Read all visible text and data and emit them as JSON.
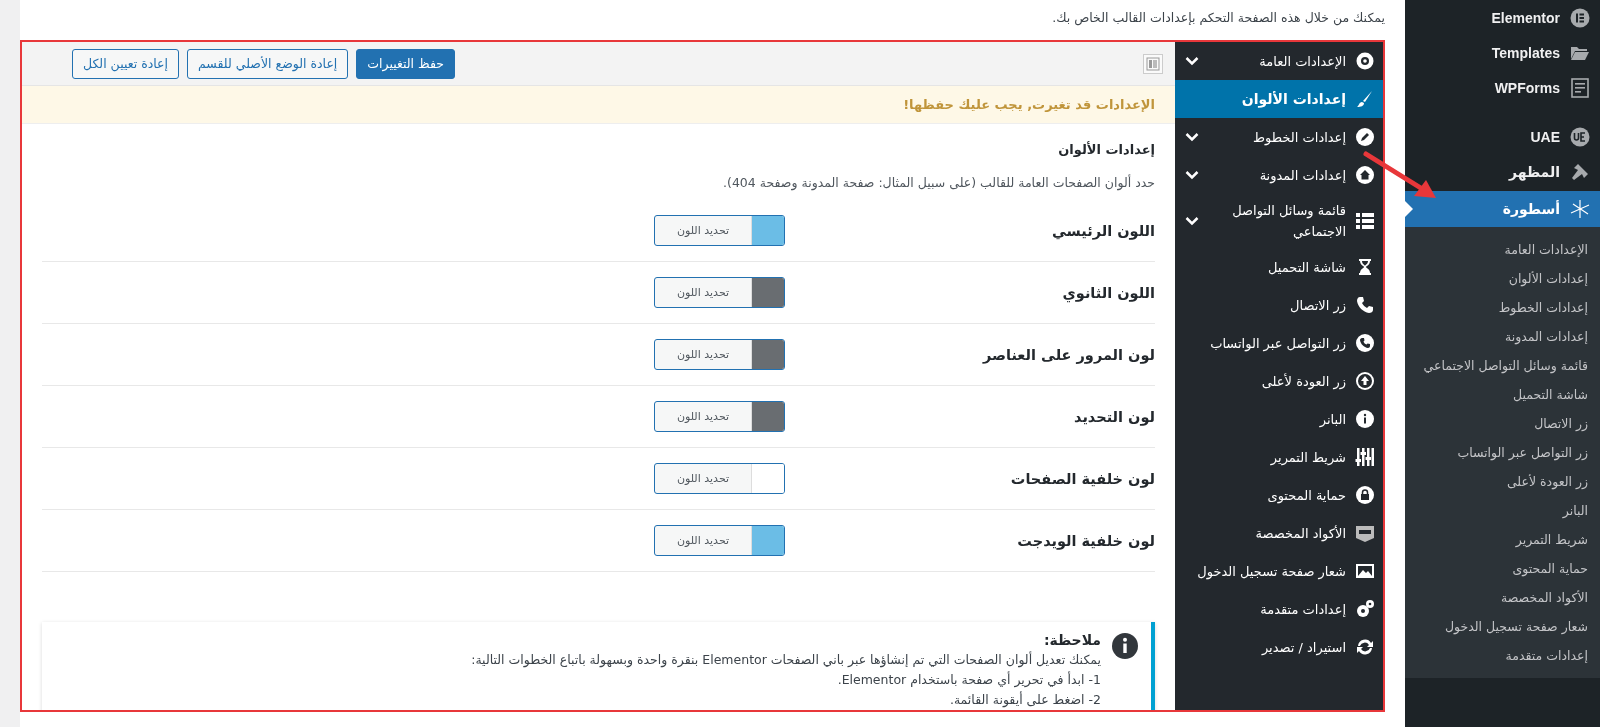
{
  "page_intro": "يمكنك من خلال هذه الصفحة التحكم بإعدادات القالب الخاص بك.",
  "toolbar": {
    "buttons": [
      {
        "label": "حفظ التغييرات",
        "kind": "primary"
      },
      {
        "label": "إعادة الوضع الأصلي للقسم",
        "kind": "secondary"
      },
      {
        "label": "إعادة تعيين الكل",
        "kind": "secondary"
      }
    ]
  },
  "notice": "الإعدادات قد تغيرت, يجب عليك حفظها!",
  "color_settings": {
    "title": "إعدادات الألوان",
    "description": "حدد ألوان الصفحات العامة للقالب (على سبيل المثال: صفحة المدونة وصفحة 404).",
    "rows": [
      {
        "label": "اللون الرئيسي",
        "button": "تحديد اللون",
        "color": "#6bbde6"
      },
      {
        "label": "اللون الثانوي",
        "button": "تحديد اللون",
        "color": "#696d71"
      },
      {
        "label": "لون المرور على العناصر",
        "button": "تحديد اللون",
        "color": "#696d71"
      },
      {
        "label": "لون التحديد",
        "button": "تحديد اللون",
        "color": "#696d71"
      },
      {
        "label": "لون خلفية الصفحات",
        "button": "تحديد اللون",
        "color": "#ffffff"
      },
      {
        "label": "لون خلفية الويدجت",
        "button": "تحديد اللون",
        "color": "#6bbde6"
      }
    ]
  },
  "note": {
    "title": "ملاحظة:",
    "lines": [
      "يمكنك تعديل ألوان الصفحات التي تم إنشاؤها عبر باني الصفحات Elementor بنقرة واحدة وبسهولة باتباع الخطوات التالية:",
      "1- ابدأ في تحرير أي صفحة باستخدام Elementor.",
      "2- اضغط على أيقونة القائمة."
    ]
  },
  "options_sidebar": {
    "items": [
      {
        "label": "الإعدادات العامة",
        "selected": false,
        "expandable": true
      },
      {
        "label": "إعدادات الألوان",
        "selected": true,
        "expandable": false
      },
      {
        "label": "إعدادات الخطوط",
        "selected": false,
        "expandable": true
      },
      {
        "label": "إعدادات المدونة",
        "selected": false,
        "expandable": true
      },
      {
        "label": "قائمة وسائل التواصل الاجتماعي",
        "selected": false,
        "expandable": true
      },
      {
        "label": "شاشة التحميل",
        "selected": false,
        "expandable": false
      },
      {
        "label": "زر الاتصال",
        "selected": false,
        "expandable": false
      },
      {
        "label": "زر التواصل عبر الواتساب",
        "selected": false,
        "expandable": false
      },
      {
        "label": "زر العودة لأعلى",
        "selected": false,
        "expandable": false
      },
      {
        "label": "البانر",
        "selected": false,
        "expandable": false
      },
      {
        "label": "شريط التمرير",
        "selected": false,
        "expandable": false
      },
      {
        "label": "حماية المحتوى",
        "selected": false,
        "expandable": false
      },
      {
        "label": "الأكواد المخصصة",
        "selected": false,
        "expandable": false
      },
      {
        "label": "شعار صفحة تسجيل الدخول",
        "selected": false,
        "expandable": false
      },
      {
        "label": "إعدادات متقدمة",
        "selected": false,
        "expandable": false
      },
      {
        "label": "استيراد / تصدير",
        "selected": false,
        "expandable": false
      }
    ]
  },
  "admin_menu": {
    "items": [
      {
        "label": "Elementor",
        "selected": false
      },
      {
        "label": "Templates",
        "selected": false
      },
      {
        "label": "WPForms",
        "selected": false
      },
      {
        "label": "UAE",
        "selected": false
      },
      {
        "label": "المظهر",
        "selected": false
      },
      {
        "label": "أسطورة",
        "selected": true
      }
    ],
    "submenu": [
      {
        "label": "الإعدادات العامة",
        "selected": false
      },
      {
        "label": "إعدادات الألوان",
        "selected": false
      },
      {
        "label": "إعدادات الخطوط",
        "selected": false
      },
      {
        "label": "إعدادات المدونة",
        "selected": false
      },
      {
        "label": "قائمة وسائل التواصل الاجتماعي",
        "selected": false
      },
      {
        "label": "شاشة التحميل",
        "selected": false
      },
      {
        "label": "زر الاتصال",
        "selected": false
      },
      {
        "label": "زر التواصل عبر الواتساب",
        "selected": false
      },
      {
        "label": "زر العودة لأعلى",
        "selected": false
      },
      {
        "label": "البانر",
        "selected": false
      },
      {
        "label": "شريط التمرير",
        "selected": false
      },
      {
        "label": "حماية المحتوى",
        "selected": false
      },
      {
        "label": "الأكواد المخصصة",
        "selected": false
      },
      {
        "label": "شعار صفحة تسجيل الدخول",
        "selected": false
      },
      {
        "label": "إعدادات متقدمة",
        "selected": false
      }
    ]
  }
}
